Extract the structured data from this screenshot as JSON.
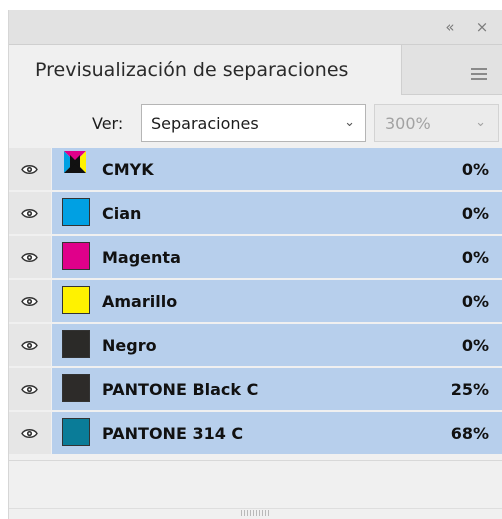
{
  "panel": {
    "title": "Previsualización de separaciones",
    "collapse_icon": "double-chevron-left-icon",
    "close_icon": "close-icon",
    "menu_icon": "hamburger-menu-icon"
  },
  "view": {
    "label": "Ver:",
    "selected": "Separaciones",
    "zoom": "300%"
  },
  "separations": [
    {
      "name": "CMYK",
      "percent": "0%",
      "swatch": "cmyk",
      "color": ""
    },
    {
      "name": "Cian",
      "percent": "0%",
      "swatch": "solid",
      "color": "#00a0e3"
    },
    {
      "name": "Magenta",
      "percent": "0%",
      "swatch": "solid",
      "color": "#e0008a"
    },
    {
      "name": "Amarillo",
      "percent": "0%",
      "swatch": "solid",
      "color": "#fff200"
    },
    {
      "name": "Negro",
      "percent": "0%",
      "swatch": "solid",
      "color": "#2b2a28"
    },
    {
      "name": "PANTONE Black C",
      "percent": "25%",
      "swatch": "solid",
      "color": "#2d2b29"
    },
    {
      "name": "PANTONE 314 C",
      "percent": "68%",
      "swatch": "solid",
      "color": "#0a7c98"
    }
  ],
  "colors": {
    "row_highlight": "#b7cfec",
    "panel_bg": "#f0f0f0"
  }
}
